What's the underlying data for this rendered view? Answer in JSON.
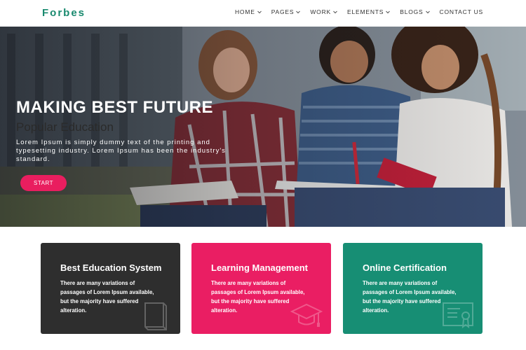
{
  "header": {
    "logo": "Forbes",
    "nav": [
      {
        "label": "HOME",
        "dropdown": true
      },
      {
        "label": "PAGES",
        "dropdown": true
      },
      {
        "label": "WORK",
        "dropdown": true
      },
      {
        "label": "ELEMENTS",
        "dropdown": true
      },
      {
        "label": "BLOGS",
        "dropdown": true
      },
      {
        "label": "CONTACT US",
        "dropdown": false
      }
    ]
  },
  "hero": {
    "title": "MAKING BEST FUTURE",
    "subtitle": "Popular Education",
    "text": "Lorem Ipsum is simply dummy text of the printing and typesetting industry. Lorem Ipsum has been the industry's standard.",
    "button_label": "START"
  },
  "cards": [
    {
      "title": "Best Education System",
      "text": "There are many variations of passages of Lorem Ipsum available, but the majority have suffered alteration.",
      "color": "#2e2e2e",
      "icon": "book-icon"
    },
    {
      "title": "Learning Management",
      "text": "There are many variations of passages of Lorem Ipsum available, but the majority have suffered alteration.",
      "color": "#ea1e63",
      "icon": "graduation-cap-icon"
    },
    {
      "title": "Online Certification",
      "text": "There are many variations of passages of Lorem Ipsum available, but the majority have suffered alteration.",
      "color": "#178e74",
      "icon": "certificate-icon"
    }
  ],
  "colors": {
    "brand": "#1a8a6f",
    "accent": "#e91e5f"
  }
}
